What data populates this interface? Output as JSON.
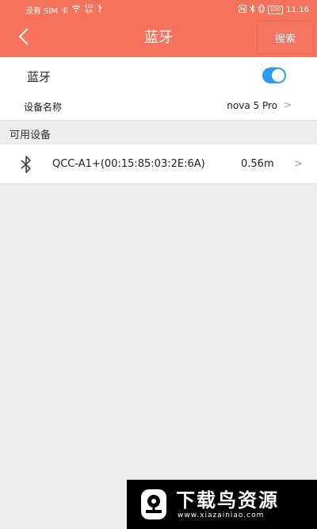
{
  "status_bar": {
    "carrier": "没有 SIM 卡",
    "net_speed_value": "419",
    "net_speed_unit": "B/s",
    "battery": "100",
    "time": "11:16"
  },
  "header": {
    "title": "蓝牙",
    "search_label": "搜索"
  },
  "bluetooth": {
    "label": "蓝牙",
    "enabled": true
  },
  "device_name": {
    "label": "设备名称",
    "value": "nova 5 Pro"
  },
  "available": {
    "title": "可用设备",
    "devices": [
      {
        "name": "QCC-A1+(00:15:85:03:2E:6A)",
        "distance": "0.56m",
        "icon": "bluetooth-icon"
      }
    ]
  },
  "watermark": {
    "title": "下载鸟资源",
    "url": "www.xiazainiao.com"
  },
  "colors": {
    "header": "#f5735c",
    "toggle_on": "#2f9bf0",
    "background": "#ececec"
  }
}
